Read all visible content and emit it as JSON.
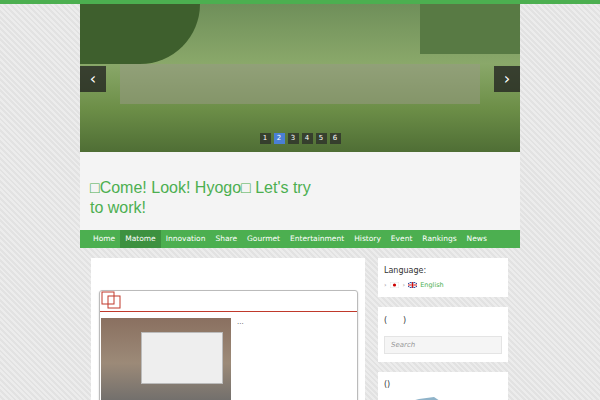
{
  "site": {
    "title": "□Come! Look! Hyogo□ Let's try to work!"
  },
  "slider": {
    "prev": "‹",
    "next": "›",
    "pages": [
      {
        "label": "1",
        "selected": false
      },
      {
        "label": "2",
        "selected": true
      },
      {
        "label": "3",
        "selected": false
      },
      {
        "label": "4",
        "selected": false
      },
      {
        "label": "5",
        "selected": false
      },
      {
        "label": "6",
        "selected": false
      }
    ]
  },
  "nav": [
    {
      "label": "Home",
      "selected": false
    },
    {
      "label": "Matome",
      "selected": true
    },
    {
      "label": "Innovation",
      "selected": false
    },
    {
      "label": "Share",
      "selected": false
    },
    {
      "label": "Gourmet",
      "selected": false
    },
    {
      "label": "Entertainment",
      "selected": false
    },
    {
      "label": "History",
      "selected": false
    },
    {
      "label": "Event",
      "selected": false
    },
    {
      "label": "Rankings",
      "selected": false
    },
    {
      "label": "News",
      "selected": false
    }
  ],
  "post": {
    "excerpt": "..."
  },
  "sidebar": {
    "language": {
      "title": "Language:",
      "options": [
        {
          "label": "",
          "flag": "jp"
        },
        {
          "label": "English",
          "flag": "gb"
        }
      ]
    },
    "search": {
      "title": "(　　)",
      "placeholder": "Search"
    },
    "map": {
      "title": "()"
    }
  }
}
